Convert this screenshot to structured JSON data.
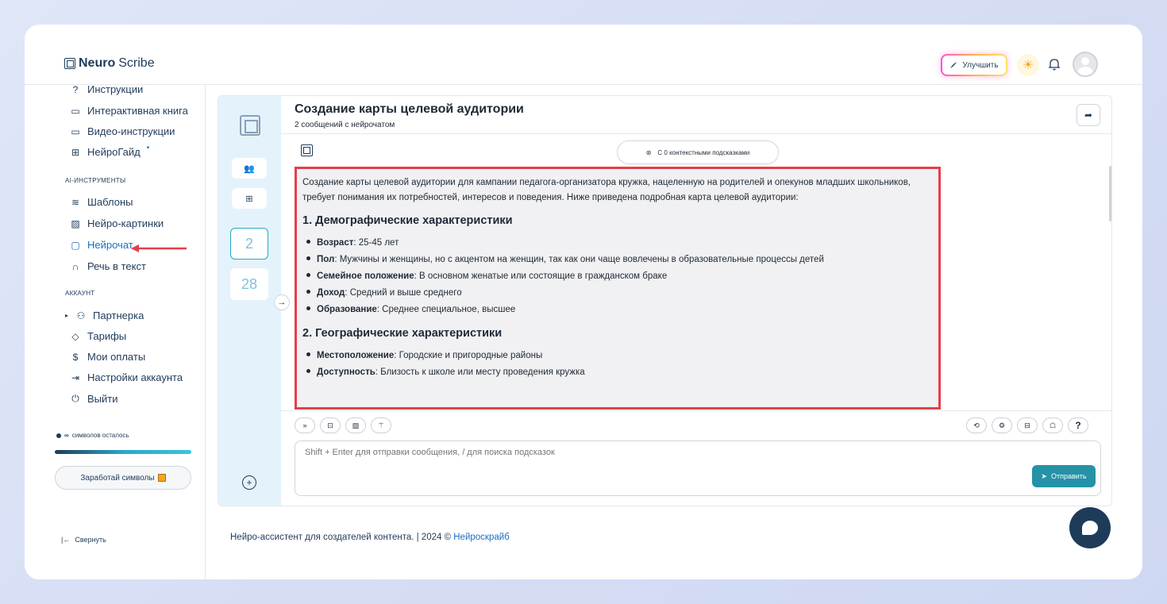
{
  "header": {
    "logo_bold": "Neuro",
    "logo_rest": "Scribe",
    "upgrade_label": "Улучшить"
  },
  "sidebar": {
    "items_top": [
      {
        "label": "Инструкции",
        "icon": "help-circle-icon"
      },
      {
        "label": "Интерактивная книга",
        "icon": "book-icon"
      },
      {
        "label": "Видео-инструкции",
        "icon": "video-icon"
      },
      {
        "label": "НейроГайд",
        "icon": "layout-icon"
      }
    ],
    "section_ai": "AI-ИНСТРУМЕНТЫ",
    "items_ai": [
      {
        "label": "Шаблоны",
        "icon": "layers-icon"
      },
      {
        "label": "Нейро-картинки",
        "icon": "image-icon"
      },
      {
        "label": "Нейрочат",
        "icon": "chat-icon",
        "active": true
      },
      {
        "label": "Речь в текст",
        "icon": "headphones-icon"
      }
    ],
    "section_account": "АККАУНТ",
    "items_account": [
      {
        "label": "Партнерка",
        "icon": "users-icon"
      },
      {
        "label": "Тарифы",
        "icon": "tag-icon"
      },
      {
        "label": "Мои оплаты",
        "icon": "dollar-icon"
      },
      {
        "label": "Настройки аккаунта",
        "icon": "login-icon"
      },
      {
        "label": "Выйти",
        "icon": "power-icon"
      }
    ],
    "symbols_infinity": "∞",
    "symbols_text": "символов осталось",
    "earn_label": "Заработай символы",
    "collapse_label": "Свернуть"
  },
  "rail": {
    "nums": [
      "2",
      "28"
    ]
  },
  "chat": {
    "title": "Создание карты целевой аудитории",
    "subtitle": "2 сообщений с нейрочатом",
    "context_label": "С 0 контекстными подсказками",
    "answer": {
      "intro": "Создание карты целевой аудитории для кампании педагога-организатора кружка, нацеленную на родителей и опекунов младших школьников, требует понимания их потребностей, интересов и поведения. Ниже приведена подробная карта целевой аудитории:",
      "sections": [
        {
          "heading": "1. Демографические характеристики",
          "items": [
            {
              "key": "Возраст",
              "value": ": 25-45 лет"
            },
            {
              "key": "Пол",
              "value": ": Мужчины и женщины, но с акцентом на женщин, так как они чаще вовлечены в образовательные процессы детей"
            },
            {
              "key": "Семейное положение",
              "value": ": В основном женатые или состоящие в гражданском браке"
            },
            {
              "key": "Доход",
              "value": ": Средний и выше среднего"
            },
            {
              "key": "Образование",
              "value": ": Среднее специальное, высшее"
            }
          ]
        },
        {
          "heading": "2. Географические характеристики",
          "items": [
            {
              "key": "Местоположение",
              "value": ": Городские и пригородные районы"
            },
            {
              "key": "Доступность",
              "value": ": Близость к школе или месту проведения кружка"
            }
          ]
        }
      ]
    },
    "input_placeholder": "Shift + Enter для отправки сообщения, / для поиска подсказок",
    "send_label": "Отправить"
  },
  "footer": {
    "text": "Нейро-ассистент для создателей контента.  | 2024 © ",
    "link": "Нейроскрайб"
  },
  "colors": {
    "accent": "#1b6ec2",
    "navy": "#1f3b5a",
    "highlight_border": "#e53e4a",
    "send_button": "#2592a8"
  }
}
